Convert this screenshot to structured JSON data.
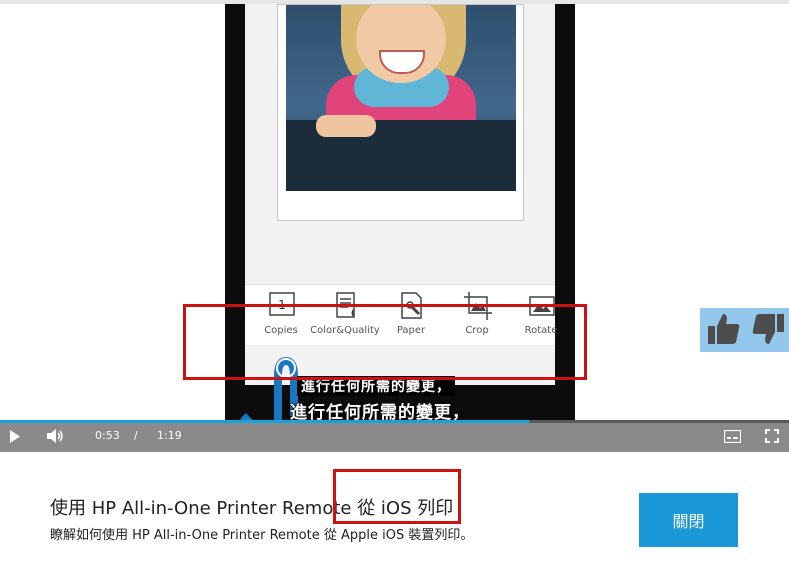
{
  "video": {
    "toolbar": {
      "items": [
        {
          "label": "Copies",
          "icon": "copies-icon"
        },
        {
          "label": "Color&Quality",
          "icon": "color-quality-icon"
        },
        {
          "label": "Paper",
          "icon": "paper-icon"
        },
        {
          "label": "Crop",
          "icon": "crop-icon"
        },
        {
          "label": "Rotate",
          "icon": "rotate-icon"
        }
      ],
      "copies_count": "1"
    },
    "subtitle_line1": "進行任何所需的變更，",
    "subtitle_line2": "進行任何所需的變更，",
    "controls": {
      "current_time": "0:53",
      "separator": "/",
      "duration": "1:19",
      "progress_percent": 67
    },
    "rating": {
      "up_icon": "thumbs-up-icon",
      "down_icon": "thumbs-down-icon"
    }
  },
  "info": {
    "title": "使用 HP All-in-One Printer Remote 從 iOS 列印",
    "description": "瞭解如何使用 HP All-in-One Printer Remote 從 Apple iOS 裝置列印。",
    "close_label": "關閉"
  },
  "colors": {
    "accent": "#1a98d8",
    "highlight": "#cc1111",
    "control_bar": "#8a8a8a"
  }
}
